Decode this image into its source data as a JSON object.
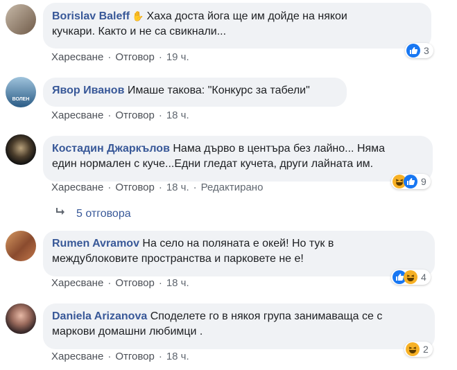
{
  "comments": [
    {
      "author": "Borislav Baleff",
      "text_line1": "Хаха доста йога ще им дойде на някои",
      "text_line2": "кучкари. Както и не са свикнали...",
      "like": "Харесване",
      "reply": "Отговор",
      "time": "19 ч.",
      "reactions": "3"
    },
    {
      "author": "Явор Иванов",
      "text_line1": "Имаше такова: \"Конкурс за табели\"",
      "like": "Харесване",
      "reply": "Отговор",
      "time": "18 ч."
    },
    {
      "author": "Костадин Джаркълов",
      "text_line1": "Нама дърво в центъра без лайно... Няма",
      "text_line2": "един нормален с куче...Едни гледат кучета, други лайната им.",
      "like": "Харесване",
      "reply": "Отговор",
      "time": "18 ч.",
      "edited": "Редактирано",
      "reactions": "9"
    },
    {
      "author": "Rumen Avramov",
      "text_line1": "На село на поляната е окей! Но тук в",
      "text_line2": "междублоковите пространства и парковете не е!",
      "like": "Харесване",
      "reply": "Отговор",
      "time": "18 ч.",
      "reactions": "4"
    },
    {
      "author": "Daniela Arizanova",
      "text_line1": "Споделете го в някоя група занимаваща се с",
      "text_line2": "маркови домашни любимци .",
      "like": "Харесване",
      "reply": "Отговор",
      "time": "18 ч.",
      "reactions": "2"
    }
  ],
  "replies_label": "5 отговора",
  "dot": "·",
  "colors": {
    "author": "#385898",
    "bubble": "#f0f2f5",
    "like_icon": "#1877f2",
    "haha_icon": "#f7b125"
  },
  "icons": [
    "wave-hand-icon",
    "like-reaction-icon",
    "haha-reaction-icon",
    "reply-arrow-icon"
  ]
}
